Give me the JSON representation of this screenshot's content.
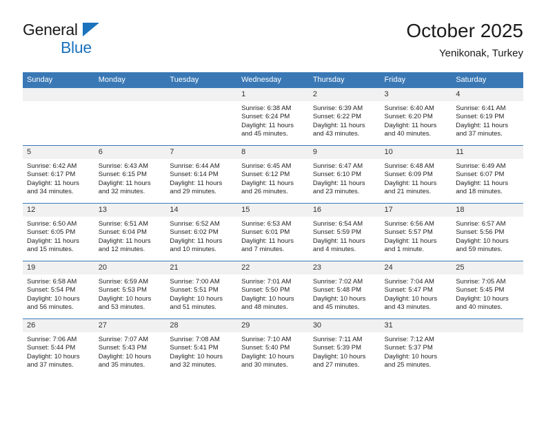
{
  "brand": {
    "name_top": "General",
    "name_bottom": "Blue",
    "triangle_color": "#1b72bd"
  },
  "header": {
    "title": "October 2025",
    "subtitle": "Yenikonak, Turkey"
  },
  "theme": {
    "header_blue": "#3a78b5",
    "daynum_band": "#f1f1f1",
    "text": "#1f1f1f"
  },
  "weekdays": [
    "Sunday",
    "Monday",
    "Tuesday",
    "Wednesday",
    "Thursday",
    "Friday",
    "Saturday"
  ],
  "weeks": [
    [
      {
        "day": "",
        "empty": true
      },
      {
        "day": "",
        "empty": true
      },
      {
        "day": "",
        "empty": true
      },
      {
        "day": "1",
        "sunrise": "Sunrise: 6:38 AM",
        "sunset": "Sunset: 6:24 PM",
        "daylight": "Daylight: 11 hours and 45 minutes."
      },
      {
        "day": "2",
        "sunrise": "Sunrise: 6:39 AM",
        "sunset": "Sunset: 6:22 PM",
        "daylight": "Daylight: 11 hours and 43 minutes."
      },
      {
        "day": "3",
        "sunrise": "Sunrise: 6:40 AM",
        "sunset": "Sunset: 6:20 PM",
        "daylight": "Daylight: 11 hours and 40 minutes."
      },
      {
        "day": "4",
        "sunrise": "Sunrise: 6:41 AM",
        "sunset": "Sunset: 6:19 PM",
        "daylight": "Daylight: 11 hours and 37 minutes."
      }
    ],
    [
      {
        "day": "5",
        "sunrise": "Sunrise: 6:42 AM",
        "sunset": "Sunset: 6:17 PM",
        "daylight": "Daylight: 11 hours and 34 minutes."
      },
      {
        "day": "6",
        "sunrise": "Sunrise: 6:43 AM",
        "sunset": "Sunset: 6:15 PM",
        "daylight": "Daylight: 11 hours and 32 minutes."
      },
      {
        "day": "7",
        "sunrise": "Sunrise: 6:44 AM",
        "sunset": "Sunset: 6:14 PM",
        "daylight": "Daylight: 11 hours and 29 minutes."
      },
      {
        "day": "8",
        "sunrise": "Sunrise: 6:45 AM",
        "sunset": "Sunset: 6:12 PM",
        "daylight": "Daylight: 11 hours and 26 minutes."
      },
      {
        "day": "9",
        "sunrise": "Sunrise: 6:47 AM",
        "sunset": "Sunset: 6:10 PM",
        "daylight": "Daylight: 11 hours and 23 minutes."
      },
      {
        "day": "10",
        "sunrise": "Sunrise: 6:48 AM",
        "sunset": "Sunset: 6:09 PM",
        "daylight": "Daylight: 11 hours and 21 minutes."
      },
      {
        "day": "11",
        "sunrise": "Sunrise: 6:49 AM",
        "sunset": "Sunset: 6:07 PM",
        "daylight": "Daylight: 11 hours and 18 minutes."
      }
    ],
    [
      {
        "day": "12",
        "sunrise": "Sunrise: 6:50 AM",
        "sunset": "Sunset: 6:05 PM",
        "daylight": "Daylight: 11 hours and 15 minutes."
      },
      {
        "day": "13",
        "sunrise": "Sunrise: 6:51 AM",
        "sunset": "Sunset: 6:04 PM",
        "daylight": "Daylight: 11 hours and 12 minutes."
      },
      {
        "day": "14",
        "sunrise": "Sunrise: 6:52 AM",
        "sunset": "Sunset: 6:02 PM",
        "daylight": "Daylight: 11 hours and 10 minutes."
      },
      {
        "day": "15",
        "sunrise": "Sunrise: 6:53 AM",
        "sunset": "Sunset: 6:01 PM",
        "daylight": "Daylight: 11 hours and 7 minutes."
      },
      {
        "day": "16",
        "sunrise": "Sunrise: 6:54 AM",
        "sunset": "Sunset: 5:59 PM",
        "daylight": "Daylight: 11 hours and 4 minutes."
      },
      {
        "day": "17",
        "sunrise": "Sunrise: 6:56 AM",
        "sunset": "Sunset: 5:57 PM",
        "daylight": "Daylight: 11 hours and 1 minute."
      },
      {
        "day": "18",
        "sunrise": "Sunrise: 6:57 AM",
        "sunset": "Sunset: 5:56 PM",
        "daylight": "Daylight: 10 hours and 59 minutes."
      }
    ],
    [
      {
        "day": "19",
        "sunrise": "Sunrise: 6:58 AM",
        "sunset": "Sunset: 5:54 PM",
        "daylight": "Daylight: 10 hours and 56 minutes."
      },
      {
        "day": "20",
        "sunrise": "Sunrise: 6:59 AM",
        "sunset": "Sunset: 5:53 PM",
        "daylight": "Daylight: 10 hours and 53 minutes."
      },
      {
        "day": "21",
        "sunrise": "Sunrise: 7:00 AM",
        "sunset": "Sunset: 5:51 PM",
        "daylight": "Daylight: 10 hours and 51 minutes."
      },
      {
        "day": "22",
        "sunrise": "Sunrise: 7:01 AM",
        "sunset": "Sunset: 5:50 PM",
        "daylight": "Daylight: 10 hours and 48 minutes."
      },
      {
        "day": "23",
        "sunrise": "Sunrise: 7:02 AM",
        "sunset": "Sunset: 5:48 PM",
        "daylight": "Daylight: 10 hours and 45 minutes."
      },
      {
        "day": "24",
        "sunrise": "Sunrise: 7:04 AM",
        "sunset": "Sunset: 5:47 PM",
        "daylight": "Daylight: 10 hours and 43 minutes."
      },
      {
        "day": "25",
        "sunrise": "Sunrise: 7:05 AM",
        "sunset": "Sunset: 5:45 PM",
        "daylight": "Daylight: 10 hours and 40 minutes."
      }
    ],
    [
      {
        "day": "26",
        "sunrise": "Sunrise: 7:06 AM",
        "sunset": "Sunset: 5:44 PM",
        "daylight": "Daylight: 10 hours and 37 minutes."
      },
      {
        "day": "27",
        "sunrise": "Sunrise: 7:07 AM",
        "sunset": "Sunset: 5:43 PM",
        "daylight": "Daylight: 10 hours and 35 minutes."
      },
      {
        "day": "28",
        "sunrise": "Sunrise: 7:08 AM",
        "sunset": "Sunset: 5:41 PM",
        "daylight": "Daylight: 10 hours and 32 minutes."
      },
      {
        "day": "29",
        "sunrise": "Sunrise: 7:10 AM",
        "sunset": "Sunset: 5:40 PM",
        "daylight": "Daylight: 10 hours and 30 minutes."
      },
      {
        "day": "30",
        "sunrise": "Sunrise: 7:11 AM",
        "sunset": "Sunset: 5:39 PM",
        "daylight": "Daylight: 10 hours and 27 minutes."
      },
      {
        "day": "31",
        "sunrise": "Sunrise: 7:12 AM",
        "sunset": "Sunset: 5:37 PM",
        "daylight": "Daylight: 10 hours and 25 minutes."
      },
      {
        "day": "",
        "empty": true
      }
    ]
  ]
}
